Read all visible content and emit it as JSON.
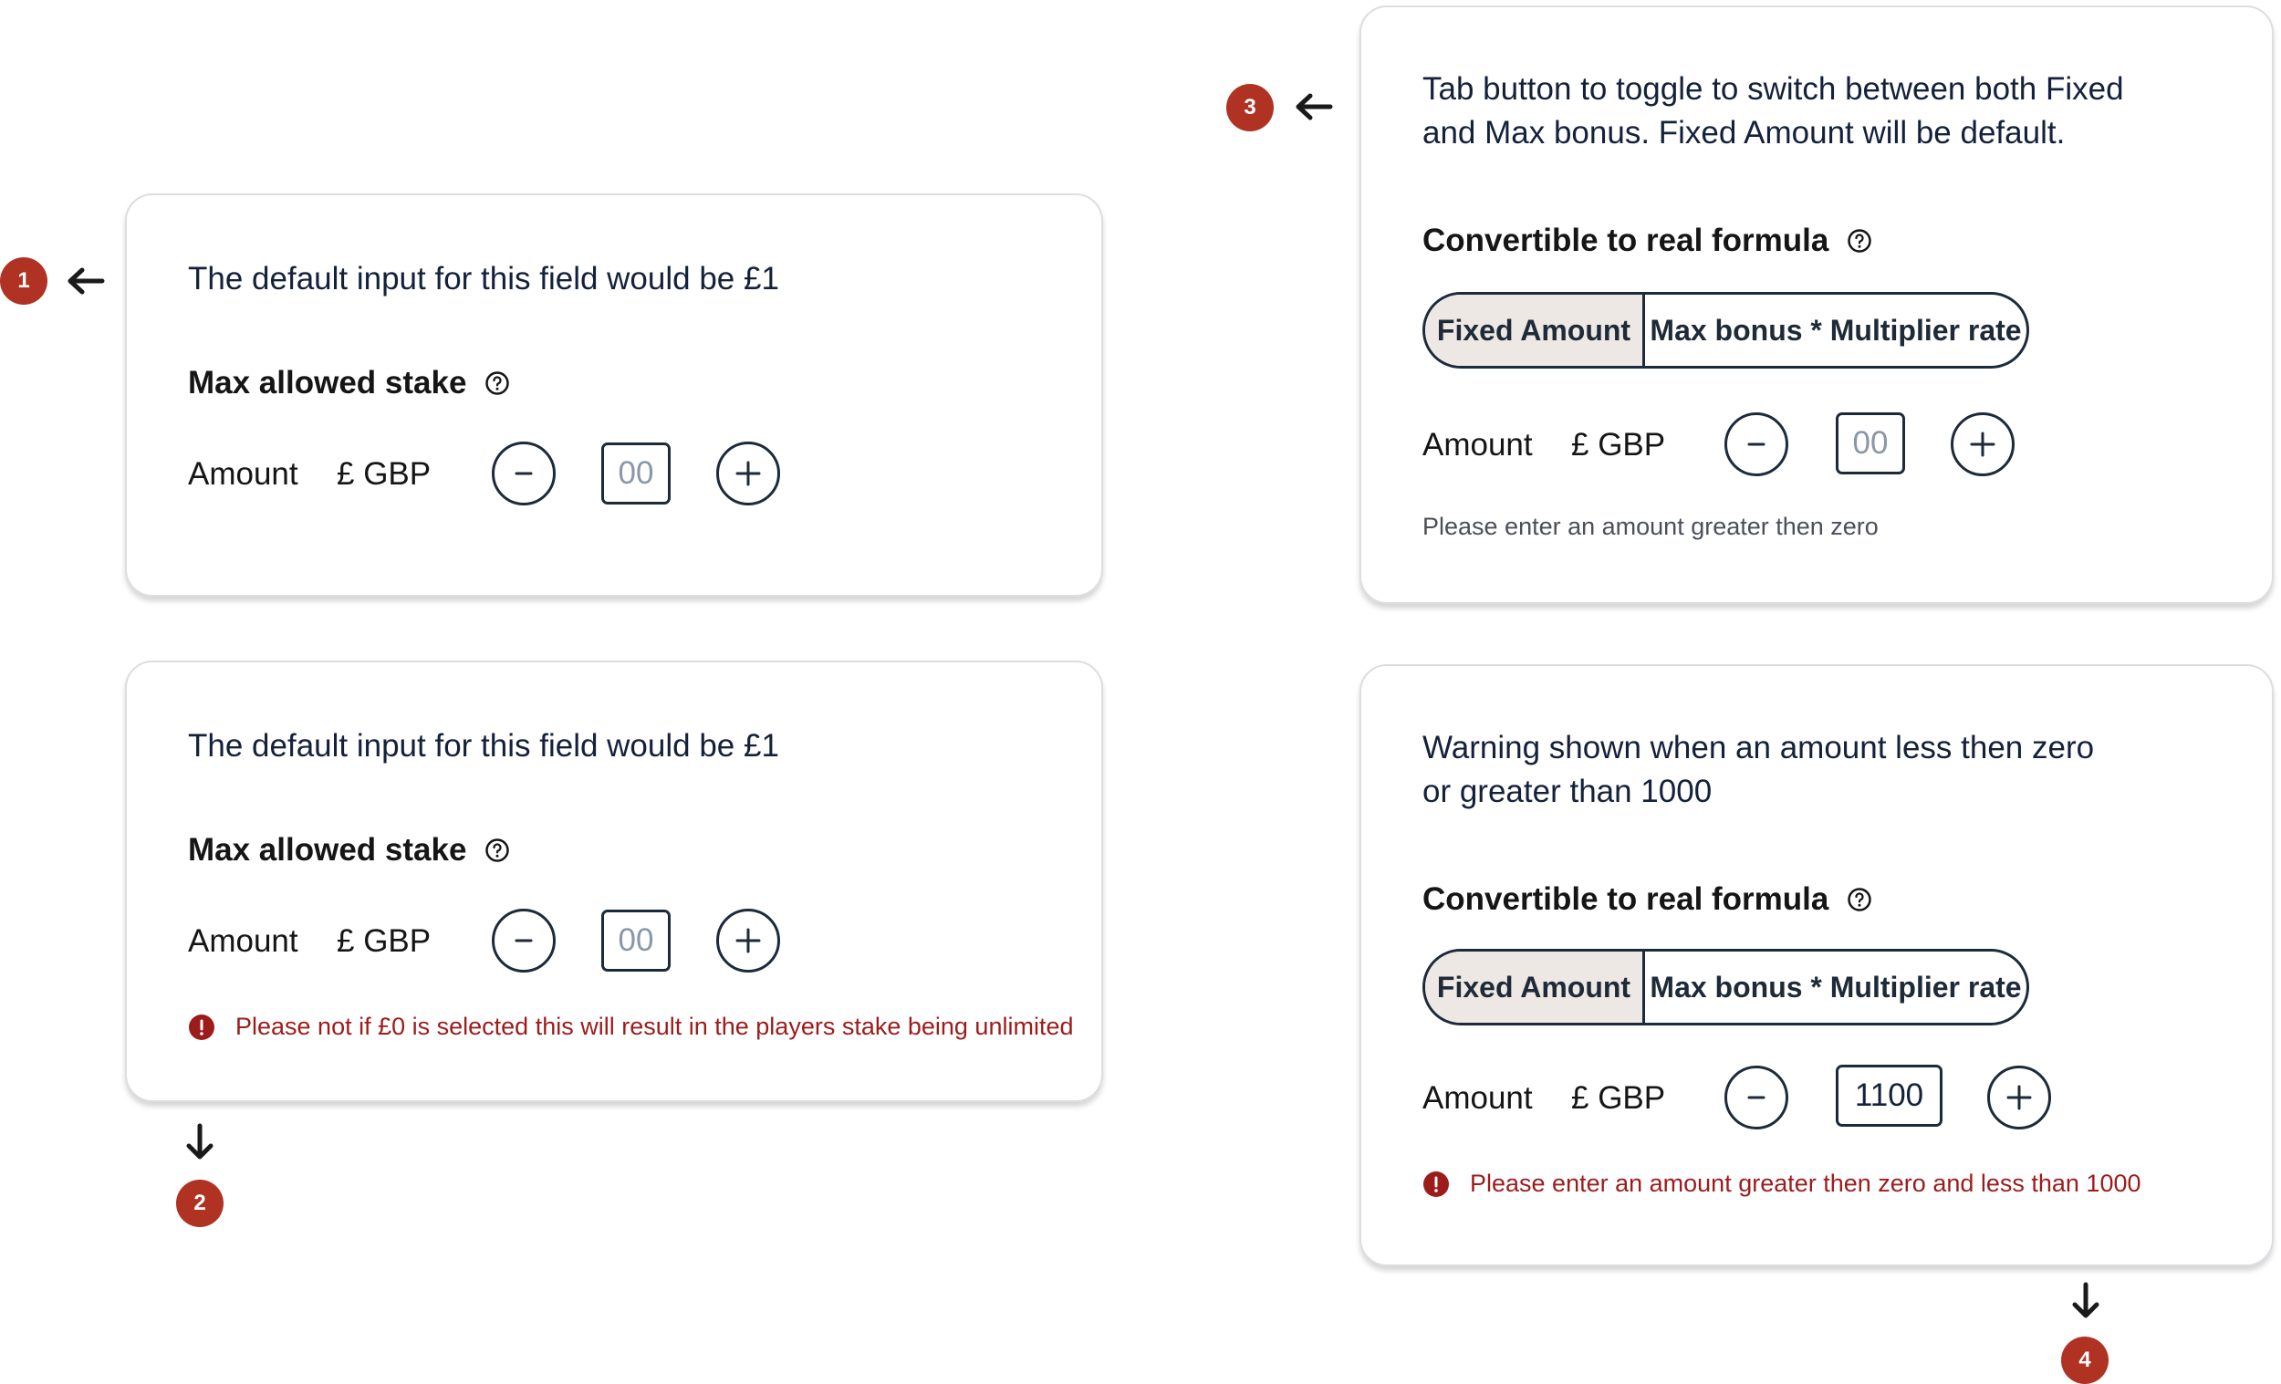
{
  "annotations": [
    {
      "number": "1"
    },
    {
      "number": "2"
    },
    {
      "number": "3"
    },
    {
      "number": "4"
    }
  ],
  "card1": {
    "description": "The default input for this field would be £1",
    "heading": "Max allowed stake",
    "amount_label": "Amount",
    "currency": "£ GBP",
    "value": "00"
  },
  "card2": {
    "description": "The default input for this field would be £1",
    "heading": "Max allowed stake",
    "amount_label": "Amount",
    "currency": "£ GBP",
    "value": "00",
    "error": "Please not if £0 is selected this will result in the players stake being unlimited"
  },
  "card3": {
    "description_line1": "Tab button to toggle to switch between both Fixed",
    "description_line2": "and Max bonus. Fixed Amount will be default.",
    "heading": "Convertible to real formula",
    "tabs": [
      "Fixed Amount",
      "Max bonus * Multiplier rate"
    ],
    "active_tab": "Fixed Amount",
    "amount_label": "Amount",
    "currency": "£ GBP",
    "value": "00",
    "hint": "Please enter an amount greater then zero"
  },
  "card4": {
    "description_line1": "Warning shown when an amount less then zero",
    "description_line2": "or greater than 1000",
    "heading": "Convertible to real formula",
    "tabs": [
      "Fixed Amount",
      "Max bonus * Multiplier rate"
    ],
    "active_tab": "Fixed Amount",
    "amount_label": "Amount",
    "currency": "£ GBP",
    "value": "1100",
    "error": "Please enter an amount greater then zero and less than 1000"
  },
  "icons": {
    "help": "help-circle-icon",
    "minus": "minus-icon",
    "plus": "plus-icon",
    "error": "alert-circle-icon",
    "arrow_left": "arrow-left-icon",
    "arrow_down": "arrow-down-icon"
  },
  "colors": {
    "badge": "#b03222",
    "error_text": "#9c1c1c",
    "active_tab_bg": "#ede8e4",
    "border": "#1d2a3a"
  }
}
